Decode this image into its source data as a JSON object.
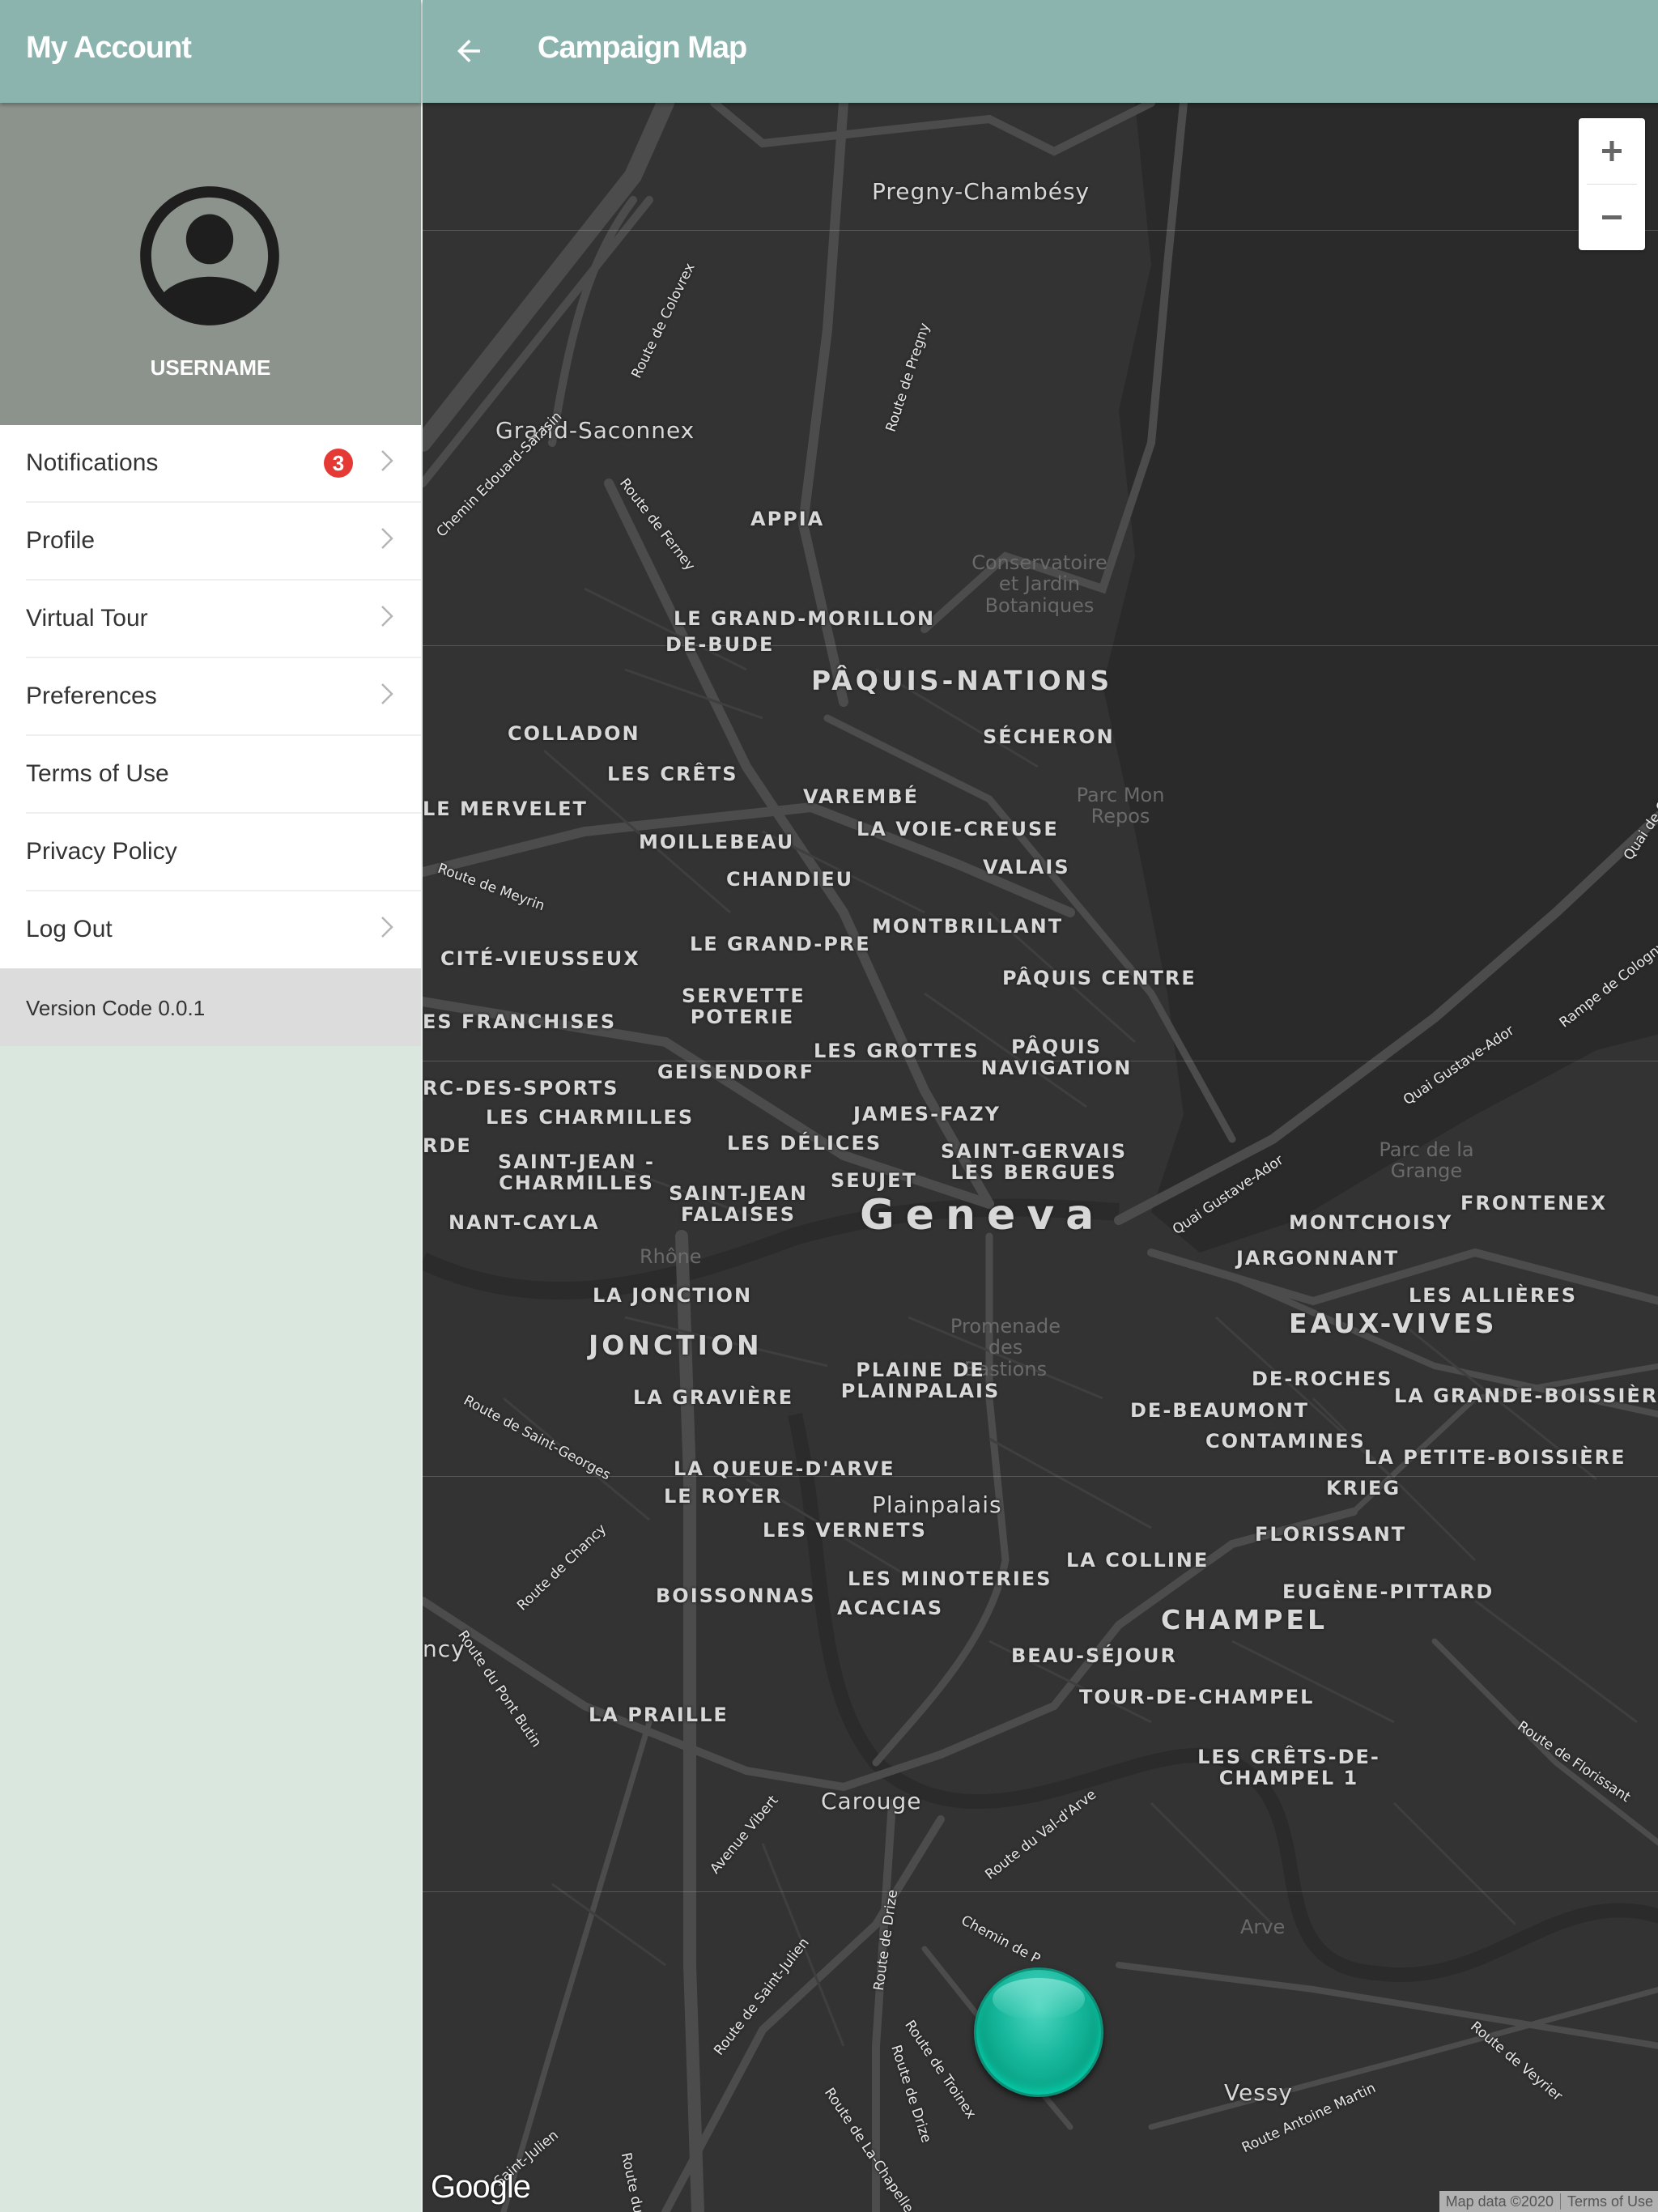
{
  "sidebar": {
    "title": "My Account",
    "username": "USERNAME",
    "menu": [
      {
        "label": "Notifications",
        "badge": "3",
        "chevron": true
      },
      {
        "label": "Profile",
        "chevron": true
      },
      {
        "label": "Virtual Tour",
        "chevron": true
      },
      {
        "label": "Preferences",
        "chevron": true
      },
      {
        "label": "Terms of Use",
        "chevron": false
      },
      {
        "label": "Privacy Policy",
        "chevron": false
      },
      {
        "label": "Log Out",
        "chevron": true
      }
    ],
    "version": "Version Code 0.0.1"
  },
  "header": {
    "title": "Campaign Map",
    "back_icon": "arrow-left-icon"
  },
  "map": {
    "zoom_in": "+",
    "zoom_out": "−",
    "google_logo": "Google",
    "attribution": "Map data ©2020",
    "terms": "Terms of Use",
    "marker_color": "#16b79c",
    "labels": {
      "pregny": "Pregny-Chambésy",
      "grand_saconnex": "Grand-Saconnex",
      "appia": "APPIA",
      "conservatoire": "Conservatoire et Jardin Botaniques",
      "grand_morillon": "LE GRAND-MORILLON",
      "de_bude": "DE-BUDE",
      "paquis_nations": "PÂQUIS-NATIONS",
      "secheron": "SÉCHERON",
      "colladon": "COLLADON",
      "les_crets": "LES CRÊTS",
      "varembe": "VAREMBÉ",
      "parc_mon_repos": "Parc Mon Repos",
      "le_mervelet": "LE MERVELET",
      "la_voie_creuse": "LA VOIE-CREUSE",
      "moillebeau": "MOILLEBEAU",
      "valais": "VALAIS",
      "chandieu": "CHANDIEU",
      "montbrillant": "MONTBRILLANT",
      "le_grand_pre": "LE GRAND-PRE",
      "cite_vieusseux": "CITÉ-VIEUSSEUX",
      "paquis_centre": "PÂQUIS CENTRE",
      "servette_poterie": "SERVETTE POTERIE",
      "franchises": "ES FRANCHISES",
      "les_grottes": "LES GROTTES",
      "paquis_navigation": "PÂQUIS NAVIGATION",
      "geisendorf": "GEISENDORF",
      "parc_des_sports": "RC-DES-SPORTS",
      "les_charmilles": "LES CHARMILLES",
      "james_fazy": "JAMES-FAZY",
      "les_delices": "LES DÉLICES",
      "saint_gervais": "SAINT-GERVAIS LES BERGUES",
      "rde": "RDE",
      "saint_jean_charmilles": "SAINT-JEAN - CHARMILLES",
      "seujet": "SEUJET",
      "saint_jean_falaises": "SAINT-JEAN FALAISES",
      "nant_cayla": "NANT-CAYLA",
      "geneva": "Geneva",
      "montchoisy": "MONTCHOISY",
      "frontenex": "FRONTENEX",
      "parc_grange": "Parc de la Grange",
      "jargonnant": "JARGONNANT",
      "rhone": "Rhône",
      "la_jonction": "LA JONCTION",
      "les_allieres": "LES ALLIÈRES",
      "jonction": "JONCTION",
      "eaux_vives": "EAUX-VIVES",
      "promenade_bastions": "Promenade des Bastions",
      "plaine_plainpalais": "PLAINE DE PLAINPALAIS",
      "de_roches": "DE-ROCHES",
      "la_graviere": "LA GRAVIÈRE",
      "de_beaumont": "DE-BEAUMONT",
      "la_grande_boissiere": "LA GRANDE-BOISSIÈRE",
      "contamines": "CONTAMINES",
      "la_petite_boissiere": "LA PETITE-BOISSIÈRE",
      "la_queue_darve": "LA QUEUE-D'ARVE",
      "le_royer": "LE ROYER",
      "krieg": "KRIEG",
      "plainpalais": "Plainpalais",
      "les_vernets": "LES VERNETS",
      "florissant": "FLORISSANT",
      "la_colline": "LA COLLINE",
      "les_minoteries": "LES MINOTERIES",
      "eugene_pittard": "EUGÈNE-PITTARD",
      "boissonnas": "BOISSONNAS",
      "acacias": "ACACIAS",
      "champel": "CHAMPEL",
      "ncy": "ncy",
      "beau_sejour": "BEAU-SÉJOUR",
      "tour_de_champel": "TOUR-DE-CHAMPEL",
      "la_praille": "LA PRAILLE",
      "les_crets_champel": "LES CRÊTS-DE-CHAMPEL 1",
      "carouge": "Carouge",
      "vessy": "Vessy",
      "arve": "Arve"
    },
    "roads": {
      "route_colovrex": "Route de Colovrex",
      "route_pregny": "Route de Pregny",
      "chemin_sarasin": "Chemin Edouard-Sarasin",
      "route_ferney": "Route de Ferney",
      "route_meyrin": "Route de Meyrin",
      "quai_gustave_ador": "Quai Gustave-Ador",
      "quai_gustave_ador_2": "Quai Gustave-Ador",
      "rampe_cologny": "Rampe de Cologny",
      "quai_de_c": "Quai de C",
      "route_saint_georges": "Route de Saint-Georges",
      "route_chancy": "Route de Chancy",
      "route_pont_butin": "Route du Pont Butin",
      "avenue_vibert": "Avenue Vibert",
      "route_val_darve": "Route du Val-d'Arve",
      "chemin_de_p": "Chemin de P",
      "route_saint_julien": "Route de Saint-Julien",
      "route_drize": "Route de Drize",
      "route_troinex": "Route de Troinex",
      "route_drize_2": "Route de Drize",
      "route_la_chapelle": "Route de La-Chapelle",
      "route_florissant": "Route de Florissant",
      "route_veyrier": "Route de Veyrier",
      "route_antoine_martin": "Route Antoine Martin",
      "saint_julien": "Saint-Julien",
      "route_du": "Route du"
    }
  }
}
